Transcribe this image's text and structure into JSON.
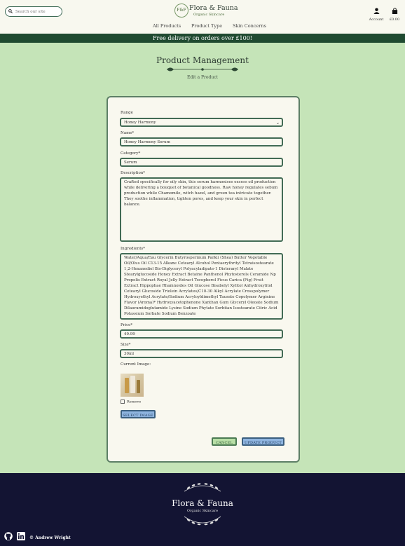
{
  "header": {
    "search_placeholder": "Search our site",
    "logo_badge": "F&F",
    "logo_name": "Flora & Fauna",
    "logo_tagline": "Organic Skincare",
    "account_label": "Account",
    "bag_total": "£0.00",
    "nav": [
      "All Products",
      "Product Type",
      "Skin Concerns"
    ]
  },
  "banner": "Free delivery on orders over £100!",
  "page": {
    "title": "Product Management",
    "subtitle": "Edit a Product"
  },
  "form": {
    "range_label": "Range",
    "range_value": "Honey Harmony",
    "name_label": "Name*",
    "name_value": "Honey Harmony Serum",
    "category_label": "Category*",
    "category_value": "Serum",
    "description_label": "Description*",
    "description_value": "Crafted specifically for oily skin, this serum harmonises excess oil production while delivering a bouquet of botanical goodness. Raw honey regulates sebum production while Chamomile, witch hazel, and green tea intricate together. They soothe inflammation, tighten pores, and keep your skin in perfect balance.",
    "ingredients_label": "Ingredients*",
    "ingredients_value": "Water/Aqua/Eau Glycerin Butyrospermum Parkii (Shea) Butter Vegetable Oil/Olus Oil C13-15 Alkane Cetearyl Alcohol Pentaerythrityl Tetraisostearate 1,2-Hexanediol Bis-Diglyceryl Polyacyladipate-1 Disteraryl Malate Stearylglucoside Honey Extract Betaine Panthenol Phytosterols Ceramide Np Propolis Extract Royal Jelly Extract Tocopherol Ficus Carica (Fig) Fruit Extract Hippophae Rhamnoides Oil Glucose Bisabolyl Xylitol Anhydroxylitol Cetearyl Glucoside Triolein Acrylates/C10-30 Alkyl Acrylate Crosspolymer Hydroxyethyl Acrylate/Sodium Acryloyldimethyl Taurate Copolymer Arginine Flavor (Aroma)* Hydroxyacetophenone Xanthan Gum Glyceryl Oleoate Sodium Dilauramidoglutamide Lysine Sodium Phytate Sorbitan Isostearate Citric Acid Potassium Sorbate Sodium Benzoate",
    "price_label": "Price*",
    "price_value": "49.99",
    "size_label": "Size*",
    "size_value": "30ml",
    "current_image_label": "Current Image:",
    "remove_label": "Remove",
    "select_image_label": "SELECT IMAGE",
    "cancel_label": "CANCEL",
    "update_label": "UPDATE PRODUCT"
  },
  "footer": {
    "name": "Flora & Fauna",
    "tagline": "Organic Skincare",
    "copyright": "© Andrew Wright"
  }
}
